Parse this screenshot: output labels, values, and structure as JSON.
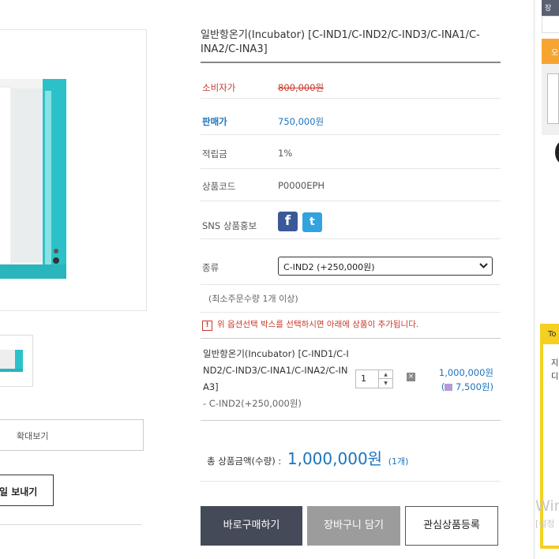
{
  "product": {
    "title": "일반항온기(Incubator) [C-IND1/C-IND2/C-IND3/C-INA1/C-INA2/C-INA3]"
  },
  "info": {
    "consumer_price_label": "소비자가",
    "consumer_price": "800,000원",
    "sale_price_label": "판매가",
    "sale_price": "750,000원",
    "points_label": "적립금",
    "points": "1%",
    "code_label": "상품코드",
    "code": "P0000EPH",
    "sns_label": "SNS 상품홍보",
    "facebook_icon": "f",
    "twitter_icon": "t"
  },
  "option": {
    "label": "종류",
    "selected": "C-IND2 (+250,000원)",
    "min_qty": "(최소주문수량 1개 이상)",
    "notice": "위 옵션선택 박스를 선택하시면 아래에 상품이 추가됩니다.",
    "notice_icon": "!"
  },
  "selected_item": {
    "name": "일반항온기(Incubator) [C-IND1/C-IND2/C-IND3/C-INA1/C-INA2/C-INA3]",
    "option": "- C-IND2(+250,000원)",
    "quantity": "1",
    "remove_icon": "×",
    "price": "1,000,000원",
    "points": "(",
    "points_value": " 7,500원)"
  },
  "total": {
    "label": "총 상품금액(수량) :",
    "amount": "1,000,000원",
    "count": "(1개)"
  },
  "buttons": {
    "buy": "바로구매하기",
    "cart": "장바구니 담기",
    "wish": "관심상품등록",
    "zoom": "확대보기",
    "mail": "일 보내기"
  },
  "sidebar": {
    "dark_tab": "장",
    "orange_tab": "오",
    "yellow_header": "To",
    "yellow_line1": "지",
    "yellow_line2": "디"
  },
  "watermark": {
    "line1": "Win",
    "line2": "[설정"
  },
  "colors": {
    "accent_blue": "#1b74bd",
    "accent_red": "#c8392b",
    "buy_button": "#454a59",
    "cart_button": "#9c9c9c",
    "sidebar_yellow": "#f5d020",
    "sidebar_orange": "#f7a531"
  }
}
